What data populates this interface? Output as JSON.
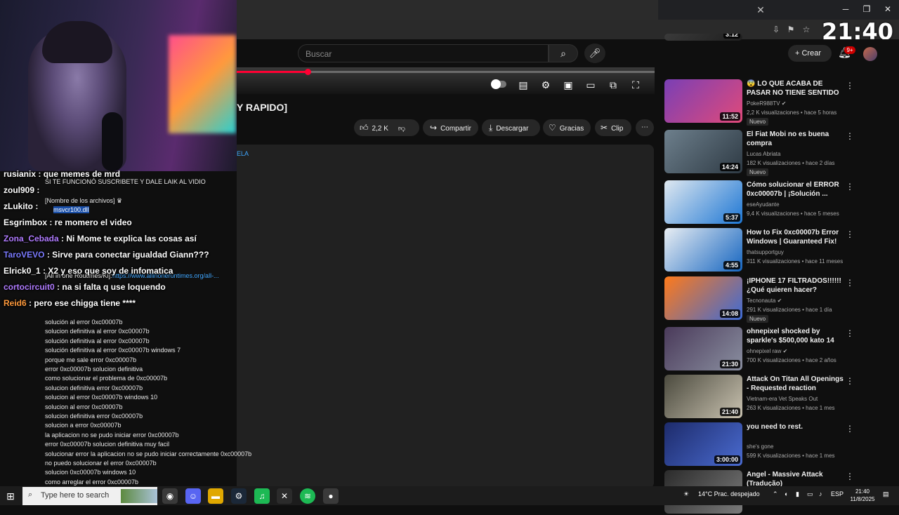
{
  "browser": {
    "clock_overlay": "21:40"
  },
  "header": {
    "search_placeholder": "Buscar",
    "create_label": "Crear",
    "notifications_badge": "9+"
  },
  "video": {
    "title_fragment": "Y RAPIDO]",
    "progress_fraction": 0.17,
    "actions": {
      "likes": "2,2 K",
      "share": "Compartir",
      "download": "Descargar",
      "thanks": "Gracias",
      "clip": "Clip"
    },
    "desc_link_fragment": "ELA"
  },
  "chat": [
    {
      "user": "rusianix",
      "color": "#ffffff",
      "text": ": que memes de mrd"
    },
    {
      "user": "zoul909",
      "color": "#ffffff",
      "text": ":"
    },
    {
      "user": "zLukito",
      "color": "#ffffff",
      "text": ":"
    },
    {
      "user": "Esgrimbox",
      "color": "#ffffff",
      "text": ": re momero el video"
    },
    {
      "user": "Zona_Cebada",
      "color": "#b07bff",
      "text": ": Ni Mome te explica las cosas así"
    },
    {
      "user": "TaroVEVO",
      "color": "#7b7bff",
      "text": ": Sirve para conectar igualdad Giann???"
    },
    {
      "user": "Elrick0_1",
      "color": "#ffffff",
      "text": ": X2 y eso que soy de infomatica"
    },
    {
      "user": "cortocircuit0",
      "color": "#b07bff",
      "text": ": na si falta q use loquendo"
    },
    {
      "user": "Reid6",
      "color": "#ff9a3c",
      "text": ": pero ese chigga tiene ****"
    }
  ],
  "description": {
    "top_lines": [
      "SI TE FUNCIONÓ SUSCRIBETE Y DALE LAIK AL VIDIO",
      "[Nombre de los archivos] ♛",
      "msvcr100.dll"
    ],
    "aio_label": "[All in one Routimes/Ki]:",
    "aio_link": "https://www.allinoneruntimes.org/all-...",
    "lines": [
      "solución al error 0xc00007b",
      "solucion definitiva al error 0xc00007b",
      "solución definitiva al error 0xc00007b",
      "solución definitiva al error 0xc00007b windows 7",
      "porque me sale error 0xc00007b",
      "error 0xc00007b solucion definitiva",
      "como solucionar el problema de 0xc00007b",
      "solucion definitiva error 0xc00007b",
      "solucion al error 0xc00007b windows 10",
      "solucion al error 0xc00007b",
      "solucion definitiva error 0xc00007b",
      "solucion a error 0xc00007b",
      "la aplicacion no se pudo iniciar error 0xc00007b",
      "error 0xc00007b solucion definitiva muy facil",
      "solucionar error la aplicacion no se pudo iniciar correctamente 0xc00007b",
      "no puedo solucionar el error 0xc00007b",
      "solucion 0xc00007b windows 10",
      "como arreglar el error 0xc00007b"
    ]
  },
  "recommended": [
    {
      "title": "",
      "channel": "",
      "meta": "",
      "duration": "3:12",
      "badge": "",
      "thumb": [
        "#3a3a3a",
        "#1f1f1f"
      ]
    },
    {
      "title": "😨 LO QUE ACABA DE PASAR NO TIENE SENTIDO",
      "channel": "PokeR988TV ✔",
      "meta": "2,2 K visualizaciones • hace 5 horas",
      "duration": "11:52",
      "badge": "Nuevo",
      "thumb": [
        "#7a3fb5",
        "#e04a7a"
      ]
    },
    {
      "title": "El Fiat Mobi no es buena compra",
      "channel": "Lucas Abriata",
      "meta": "182 K visualizaciones • hace 2 días",
      "duration": "14:24",
      "badge": "Nuevo",
      "thumb": [
        "#6d7f8c",
        "#2e3a44"
      ]
    },
    {
      "title": "Cómo solucionar el ERROR 0xc00007b | ¡Solución ...",
      "channel": "eseAyudante",
      "meta": "9,4 K visualizaciones • hace 5 meses",
      "duration": "5:37",
      "badge": "",
      "thumb": [
        "#dfe8f0",
        "#1e77d4"
      ]
    },
    {
      "title": "How to Fix 0xc00007b Error Windows | Guaranteed Fix!",
      "channel": "thatsupportguy",
      "meta": "311 K visualizaciones • hace 11 meses",
      "duration": "4:55",
      "badge": "",
      "thumb": [
        "#e9eef3",
        "#1565c0"
      ]
    },
    {
      "title": "¡IPHONE 17 FILTRADOS!!!!!! ¿Qué quieren hacer?",
      "channel": "Tecnonauta ✔",
      "meta": "291 K visualizaciones • hace 1 día",
      "duration": "14:08",
      "badge": "Nuevo",
      "thumb": [
        "#ff7a1a",
        "#3d6bd6"
      ]
    },
    {
      "title": "ohnepixel shocked by sparkle's $500,000 kato 14 capsule ...",
      "channel": "ohnepixel raw ✔",
      "meta": "700 K visualizaciones • hace 2 años",
      "duration": "21:30",
      "badge": "",
      "thumb": [
        "#4a3a5a",
        "#8a8fa0"
      ]
    },
    {
      "title": "Attack On Titan  All Openings - Requested reaction",
      "channel": "Vietnam-era Vet Speaks Out",
      "meta": "263 K visualizaciones • hace 1 mes",
      "duration": "21:40",
      "badge": "",
      "thumb": [
        "#4b4a3e",
        "#c9c2b0"
      ]
    },
    {
      "title": "you need to rest.",
      "channel": "she's gone",
      "meta": "599 K visualizaciones • hace 1 mes",
      "duration": "3:00:00",
      "badge": "",
      "thumb": [
        "#1d2b6b",
        "#4a6bd0"
      ]
    },
    {
      "title": "Angel - Massive Attack (Tradução)",
      "channel": "",
      "meta": "",
      "duration": "",
      "badge": "",
      "thumb": [
        "#2b2b2b",
        "#7a7a7a"
      ]
    }
  ],
  "taskbar": {
    "search_placeholder": "Type here to search",
    "weather": "14°C  Prac. despejado",
    "lang": "ESP",
    "time": "21:40",
    "date": "11/8/2025"
  },
  "colors": {
    "accent": "#ff0033",
    "link": "#3ea6ff",
    "background": "#0f0f0f"
  }
}
